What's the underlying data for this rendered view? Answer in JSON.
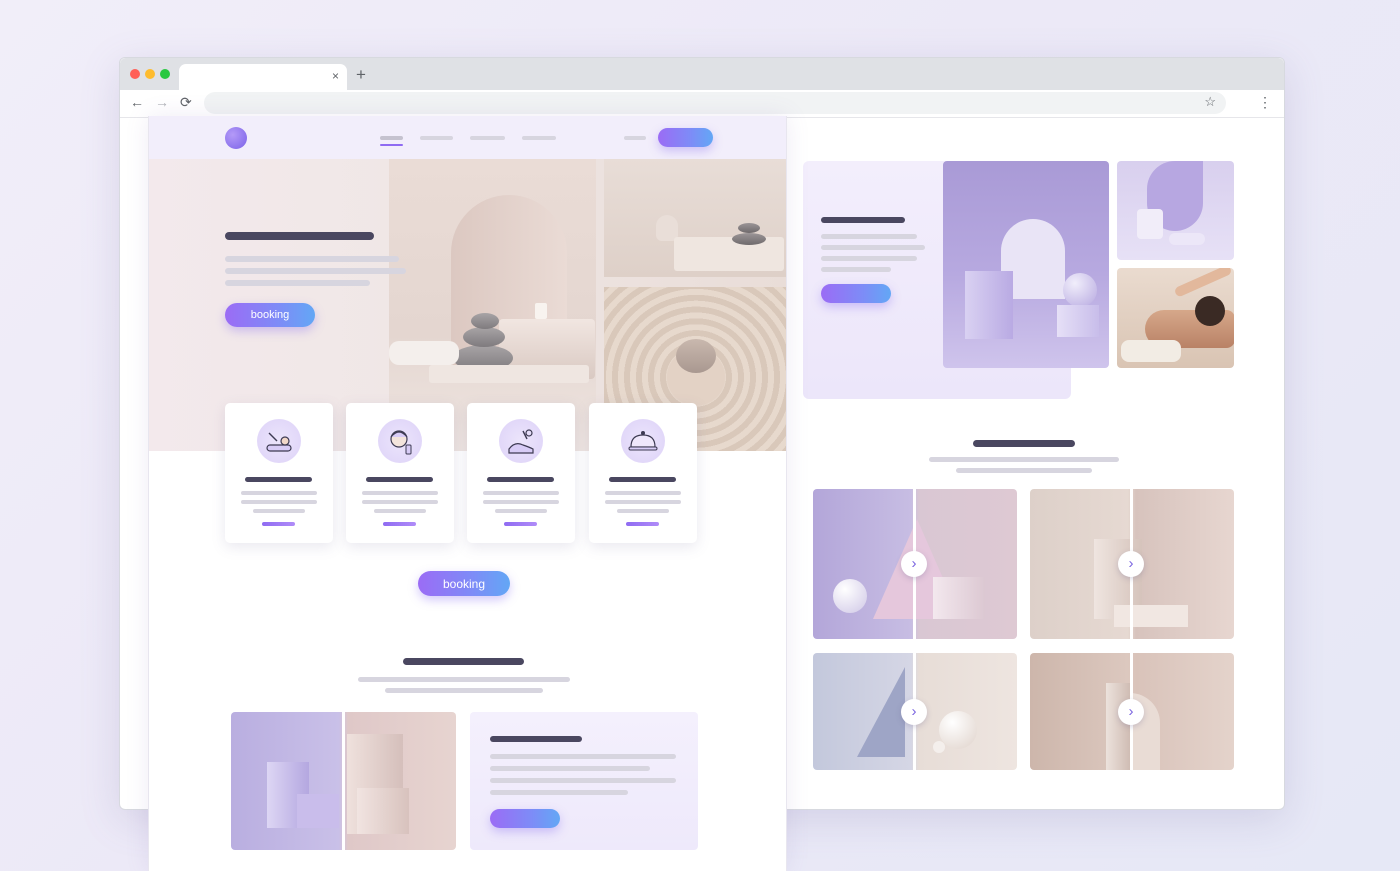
{
  "browser": {
    "tab": {
      "title": "",
      "close_glyph": "×"
    },
    "new_tab_glyph": "+",
    "nav": {
      "back_glyph": "←",
      "forward_glyph": "→",
      "reload_glyph": "⟳"
    },
    "address": {
      "value": "",
      "placeholder": ""
    },
    "bookmark_glyph": "☆",
    "menu_glyph": "⋮"
  },
  "mockup": {
    "hero": {
      "cta_label": "booking"
    },
    "services": [
      {
        "icon": "massage-icon"
      },
      {
        "icon": "facial-icon"
      },
      {
        "icon": "body-treatment-icon"
      },
      {
        "icon": "dining-cloche-icon"
      }
    ],
    "main_cta_label": "booking"
  },
  "colors": {
    "accent_purple": "#8f6bf2",
    "accent_blue": "#63a7f5",
    "text_dark_bar": "#4a4760",
    "text_light_bar": "#d7d5df",
    "panel_lavender": "#f2eefb"
  }
}
